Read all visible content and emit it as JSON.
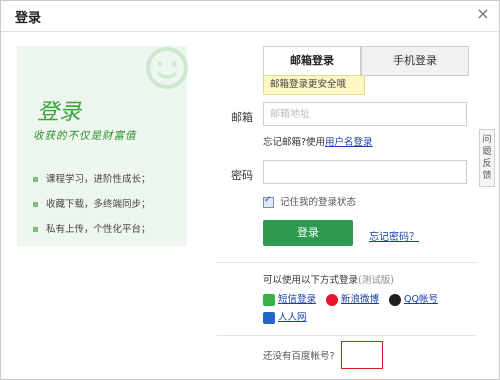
{
  "dialog": {
    "title": "登录",
    "close_glyph": "×"
  },
  "promo": {
    "title": "登录",
    "slogan": "收获的不仅是财富值",
    "features": [
      "课程学习，进阶性成长；",
      "收藏下载，多终端同步；",
      "私有上传，个性化平台；"
    ]
  },
  "tabs": {
    "email": "邮箱登录",
    "phone": "手机登录"
  },
  "tip": "邮箱登录更安全哦",
  "form": {
    "email_label": "邮箱",
    "email_placeholder": "邮箱地址",
    "forgot_email_prefix": "忘记邮箱?使用",
    "forgot_email_link": "用户名登录",
    "password_label": "密码",
    "remember": "记住我的登录状态",
    "login_button": "登录",
    "forgot_password": "忘记密码？"
  },
  "feedback": "问题反馈",
  "other": {
    "title": "可以使用以下方式登录",
    "title_note": "(测试版)",
    "options": [
      "短信登录",
      "新浪微博",
      "QQ帐号",
      "人人网"
    ]
  },
  "bottom": {
    "text": "还没有百度帐号?"
  },
  "colors": {
    "accent": "#2d9a4e",
    "link": "#1a3fa8",
    "tip_bg": "#fff6c4"
  }
}
